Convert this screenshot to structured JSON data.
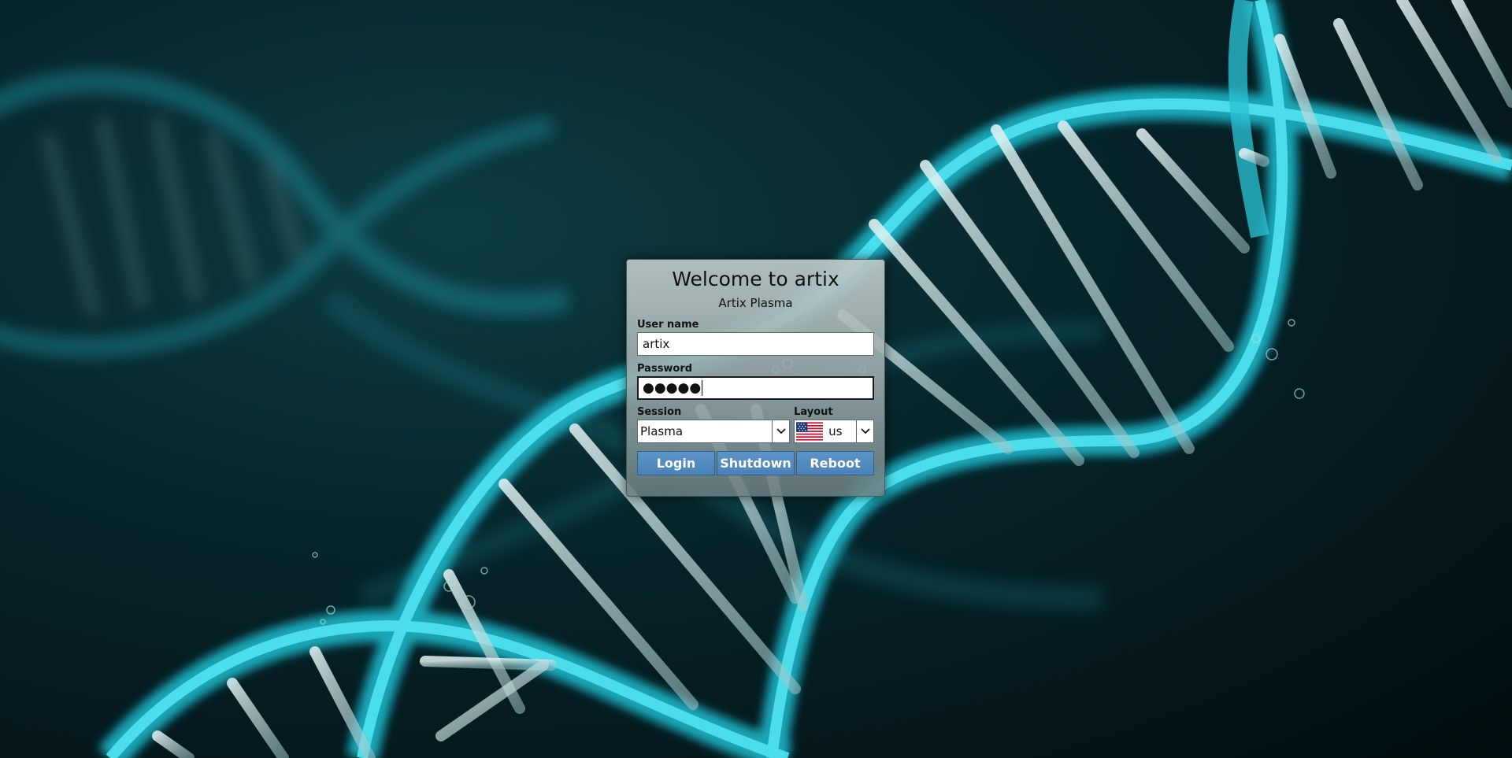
{
  "login": {
    "title": "Welcome to artix",
    "subtitle": "Artix Plasma",
    "username_label": "User name",
    "username_value": "artix",
    "password_label": "Password",
    "password_masked": "●●●●●",
    "session_label": "Session",
    "session_value": "Plasma",
    "layout_label": "Layout",
    "layout_value": "us",
    "layout_flag_icon": "us-flag-icon",
    "buttons": {
      "login": "Login",
      "shutdown": "Shutdown",
      "reboot": "Reboot"
    }
  },
  "colors": {
    "button_blue": "#4a82b8",
    "dna_cyan": "#24c8dc",
    "background_dark": "#031618"
  }
}
